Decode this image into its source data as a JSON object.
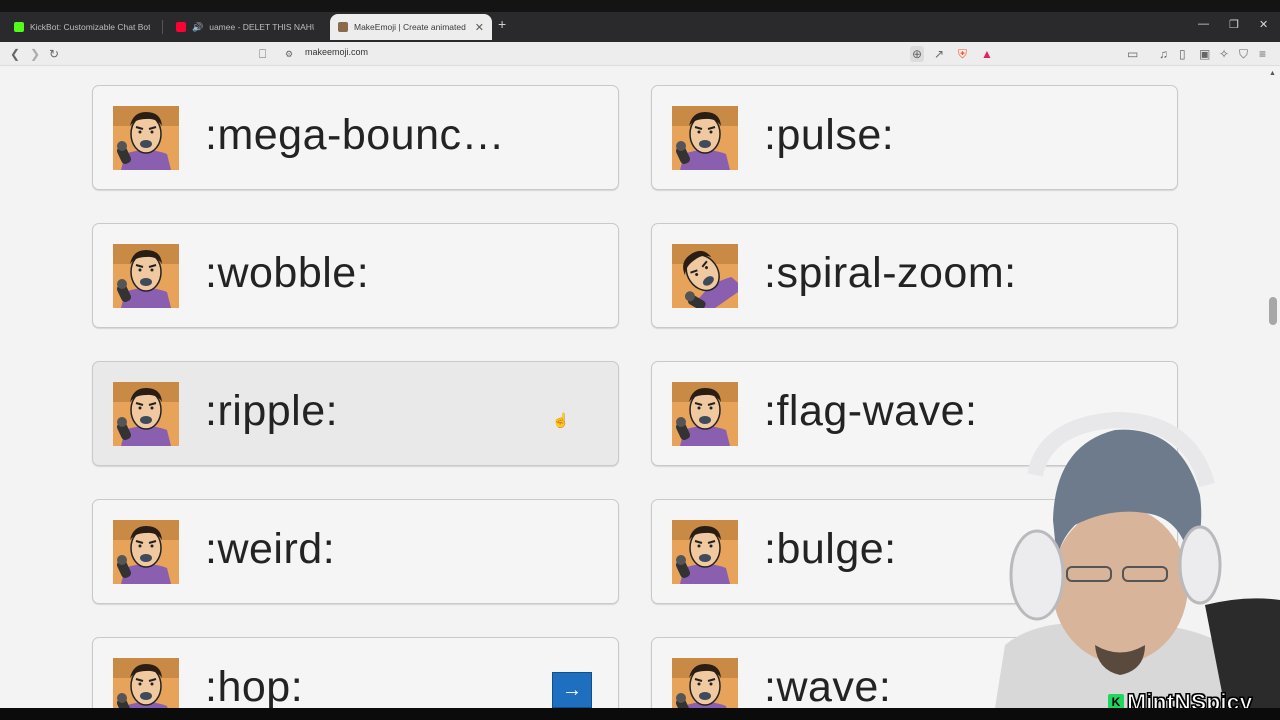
{
  "browser": {
    "tabs": [
      {
        "title": "KickBot: Customizable Chat Bot for K",
        "favicon_color": "#53fc18"
      },
      {
        "title": "uamee - DELET THIS NAHUI [HAF",
        "favicon_color": "#ff0000"
      },
      {
        "title": "MakeEmoji | Create animated",
        "favicon_color": "#8a6a4a",
        "active": true
      }
    ],
    "url": "makeemoji.com"
  },
  "emoji_cards": [
    {
      "code": ":mega-bounc…"
    },
    {
      "code": ":pulse:"
    },
    {
      "code": ":wobble:"
    },
    {
      "code": ":spiral-zoom:"
    },
    {
      "code": ":ripple:"
    },
    {
      "code": ":flag-wave:"
    },
    {
      "code": ":weird:"
    },
    {
      "code": ":bulge:"
    },
    {
      "code": ":hop:"
    },
    {
      "code": ":wave:"
    }
  ],
  "overlay": {
    "watermark": "MintNSpicy"
  },
  "colors": {
    "accent_button": "#1f6fc0",
    "kick_green": "#1ed760"
  }
}
